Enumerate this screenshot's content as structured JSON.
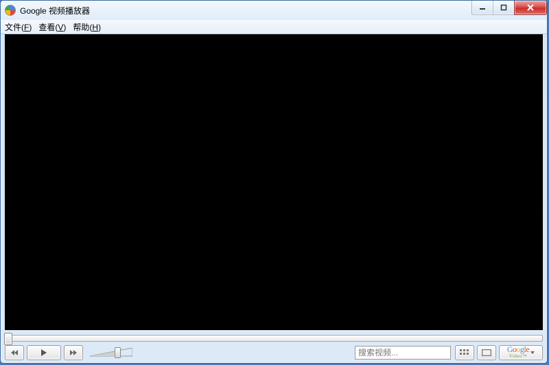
{
  "window": {
    "title": "Google 视频播放器"
  },
  "menu": {
    "file": {
      "label": "文件",
      "accel": "F"
    },
    "view": {
      "label": "查看",
      "accel": "V"
    },
    "help": {
      "label": "帮助",
      "accel": "H"
    }
  },
  "search": {
    "placeholder": "搜索视频..."
  },
  "brand": {
    "name": "Google",
    "sub": "Video",
    "tm": "™"
  },
  "icons": {
    "minimize": "minimize-icon",
    "maximize": "maximize-icon",
    "close": "close-icon",
    "previous": "previous-icon",
    "play": "play-icon",
    "next": "next-icon",
    "playlist": "playlist-icon",
    "fullscreen": "fullscreen-icon",
    "dropdown": "chevron-down-icon"
  }
}
